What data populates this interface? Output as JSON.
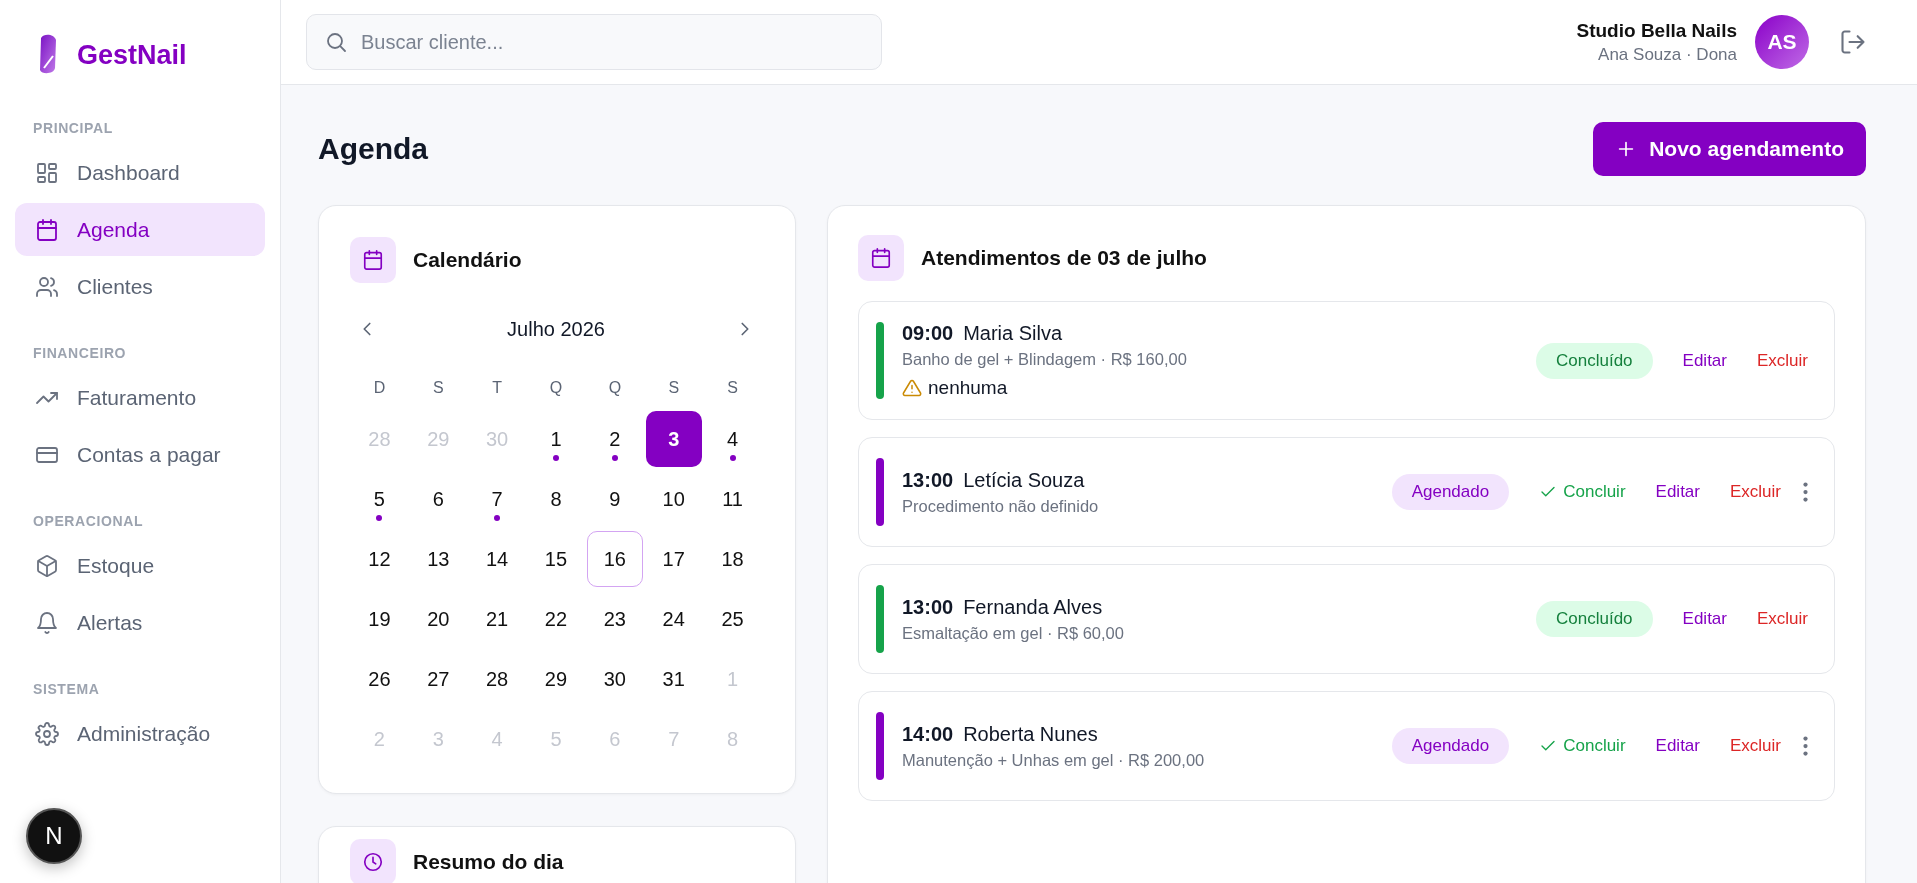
{
  "sidebar": {
    "logo": "GestNail",
    "sections": [
      {
        "title": "PRINCIPAL",
        "items": [
          {
            "label": "Dashboard",
            "selected": false
          },
          {
            "label": "Agenda",
            "selected": true
          },
          {
            "label": "Clientes",
            "selected": false
          }
        ]
      },
      {
        "title": "FINANCEIRO",
        "items": [
          {
            "label": "Faturamento",
            "selected": false
          },
          {
            "label": "Contas a pagar",
            "selected": false
          }
        ]
      },
      {
        "title": "OPERACIONAL",
        "items": [
          {
            "label": "Estoque",
            "selected": false
          },
          {
            "label": "Alertas",
            "selected": false
          }
        ]
      },
      {
        "title": "SISTEMA",
        "items": [
          {
            "label": "Administração",
            "selected": false
          }
        ]
      }
    ],
    "dev_badge": "N"
  },
  "header": {
    "search": {
      "placeholder": "Buscar cliente..."
    },
    "business": "Studio Bella Nails",
    "user": "Ana Souza · Dona",
    "avatar": "AS"
  },
  "page": {
    "title": "Agenda",
    "new_button": "Novo agendamento"
  },
  "calendar": {
    "title": "Calendário",
    "month": "Julho 2026",
    "weekdays": [
      "D",
      "S",
      "T",
      "Q",
      "Q",
      "S",
      "S"
    ],
    "days": [
      {
        "label": "28",
        "outside": true,
        "selected": false,
        "today": false,
        "has_event": false
      },
      {
        "label": "29",
        "outside": true,
        "selected": false,
        "today": false,
        "has_event": false
      },
      {
        "label": "30",
        "outside": true,
        "selected": false,
        "today": false,
        "has_event": false
      },
      {
        "label": "1",
        "outside": false,
        "selected": false,
        "today": false,
        "has_event": true
      },
      {
        "label": "2",
        "outside": false,
        "selected": false,
        "today": false,
        "has_event": true
      },
      {
        "label": "3",
        "outside": false,
        "selected": true,
        "today": false,
        "has_event": false
      },
      {
        "label": "4",
        "outside": false,
        "selected": false,
        "today": false,
        "has_event": true
      },
      {
        "label": "5",
        "outside": false,
        "selected": false,
        "today": false,
        "has_event": true
      },
      {
        "label": "6",
        "outside": false,
        "selected": false,
        "today": false,
        "has_event": false
      },
      {
        "label": "7",
        "outside": false,
        "selected": false,
        "today": false,
        "has_event": true
      },
      {
        "label": "8",
        "outside": false,
        "selected": false,
        "today": false,
        "has_event": false
      },
      {
        "label": "9",
        "outside": false,
        "selected": false,
        "today": false,
        "has_event": false
      },
      {
        "label": "10",
        "outside": false,
        "selected": false,
        "today": false,
        "has_event": false
      },
      {
        "label": "11",
        "outside": false,
        "selected": false,
        "today": false,
        "has_event": false
      },
      {
        "label": "12",
        "outside": false,
        "selected": false,
        "today": false,
        "has_event": false
      },
      {
        "label": "13",
        "outside": false,
        "selected": false,
        "today": false,
        "has_event": false
      },
      {
        "label": "14",
        "outside": false,
        "selected": false,
        "today": false,
        "has_event": false
      },
      {
        "label": "15",
        "outside": false,
        "selected": false,
        "today": false,
        "has_event": false
      },
      {
        "label": "16",
        "outside": false,
        "selected": false,
        "today": true,
        "has_event": false
      },
      {
        "label": "17",
        "outside": false,
        "selected": false,
        "today": false,
        "has_event": false
      },
      {
        "label": "18",
        "outside": false,
        "selected": false,
        "today": false,
        "has_event": false
      },
      {
        "label": "19",
        "outside": false,
        "selected": false,
        "today": false,
        "has_event": false
      },
      {
        "label": "20",
        "outside": false,
        "selected": false,
        "today": false,
        "has_event": false
      },
      {
        "label": "21",
        "outside": false,
        "selected": false,
        "today": false,
        "has_event": false
      },
      {
        "label": "22",
        "outside": false,
        "selected": false,
        "today": false,
        "has_event": false
      },
      {
        "label": "23",
        "outside": false,
        "selected": false,
        "today": false,
        "has_event": false
      },
      {
        "label": "24",
        "outside": false,
        "selected": false,
        "today": false,
        "has_event": false
      },
      {
        "label": "25",
        "outside": false,
        "selected": false,
        "today": false,
        "has_event": false
      },
      {
        "label": "26",
        "outside": false,
        "selected": false,
        "today": false,
        "has_event": false
      },
      {
        "label": "27",
        "outside": false,
        "selected": false,
        "today": false,
        "has_event": false
      },
      {
        "label": "28",
        "outside": false,
        "selected": false,
        "today": false,
        "has_event": false
      },
      {
        "label": "29",
        "outside": false,
        "selected": false,
        "today": false,
        "has_event": false
      },
      {
        "label": "30",
        "outside": false,
        "selected": false,
        "today": false,
        "has_event": false
      },
      {
        "label": "31",
        "outside": false,
        "selected": false,
        "today": false,
        "has_event": false
      },
      {
        "label": "1",
        "outside": true,
        "selected": false,
        "today": false,
        "has_event": false
      },
      {
        "label": "2",
        "outside": true,
        "selected": false,
        "today": false,
        "has_event": false
      },
      {
        "label": "3",
        "outside": true,
        "selected": false,
        "today": false,
        "has_event": false
      },
      {
        "label": "4",
        "outside": true,
        "selected": false,
        "today": false,
        "has_event": false
      },
      {
        "label": "5",
        "outside": true,
        "selected": false,
        "today": false,
        "has_event": false
      },
      {
        "label": "6",
        "outside": true,
        "selected": false,
        "today": false,
        "has_event": false
      },
      {
        "label": "7",
        "outside": true,
        "selected": false,
        "today": false,
        "has_event": false
      },
      {
        "label": "8",
        "outside": true,
        "selected": false,
        "today": false,
        "has_event": false
      }
    ]
  },
  "summary": {
    "title": "Resumo do dia"
  },
  "appointments": {
    "title": "Atendimentos de 03 de julho",
    "items": [
      {
        "time": "09:00",
        "client": "Maria Silva",
        "details": "Banho de gel + Blindagem · R$ 160,00",
        "note": "nenhuma",
        "status": {
          "label": "Concluído",
          "kind": "done"
        },
        "actions": [
          {
            "label": "Editar",
            "kind": "edit"
          },
          {
            "label": "Excluir",
            "kind": "delete"
          }
        ],
        "has_menu": false
      },
      {
        "time": "13:00",
        "client": "Letícia Souza",
        "details": "Procedimento não definido",
        "status": {
          "label": "Agendado",
          "kind": "scheduled"
        },
        "actions": [
          {
            "label": "Concluir",
            "kind": "complete"
          },
          {
            "label": "Editar",
            "kind": "edit"
          },
          {
            "label": "Excluir",
            "kind": "delete"
          }
        ],
        "has_menu": true
      },
      {
        "time": "13:00",
        "client": "Fernanda Alves",
        "details": "Esmaltação em gel · R$ 60,00",
        "status": {
          "label": "Concluído",
          "kind": "done"
        },
        "actions": [
          {
            "label": "Editar",
            "kind": "edit"
          },
          {
            "label": "Excluir",
            "kind": "delete"
          }
        ],
        "has_menu": false
      },
      {
        "time": "14:00",
        "client": "Roberta Nunes",
        "details": "Manutenção + Unhas em gel · R$ 200,00",
        "status": {
          "label": "Agendado",
          "kind": "scheduled"
        },
        "actions": [
          {
            "label": "Concluir",
            "kind": "complete"
          },
          {
            "label": "Editar",
            "kind": "edit"
          },
          {
            "label": "Excluir",
            "kind": "delete"
          }
        ],
        "has_menu": true
      }
    ]
  }
}
